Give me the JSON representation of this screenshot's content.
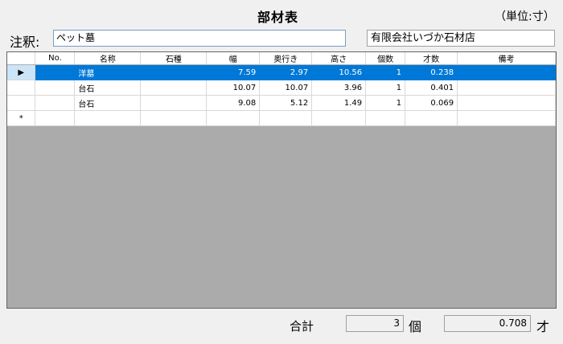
{
  "header": {
    "title": "部材表",
    "unit": "（単位:寸）"
  },
  "note": {
    "label": "注釈:",
    "value": "ペット墓"
  },
  "company": {
    "value": "有限会社いづか石材店"
  },
  "table": {
    "columns": [
      "No.",
      "名称",
      "石種",
      "幅",
      "奥行き",
      "高さ",
      "個数",
      "才数",
      "備考"
    ],
    "rows": [
      {
        "no": "",
        "name": "洋墓",
        "stone": "",
        "width": "7.59",
        "depth": "2.97",
        "height": "10.56",
        "count": "1",
        "size": "0.238",
        "note": ""
      },
      {
        "no": "",
        "name": "台石",
        "stone": "",
        "width": "10.07",
        "depth": "10.07",
        "height": "3.96",
        "count": "1",
        "size": "0.401",
        "note": ""
      },
      {
        "no": "",
        "name": "台石",
        "stone": "",
        "width": "9.08",
        "depth": "5.12",
        "height": "1.49",
        "count": "1",
        "size": "0.069",
        "note": ""
      }
    ],
    "current_row_marker": "▶",
    "new_row_marker": "*"
  },
  "footer": {
    "total_label": "合計",
    "count_value": "3",
    "count_unit": "個",
    "size_value": "0.708",
    "size_unit": "才"
  },
  "colors": {
    "selection": "#0078d7",
    "grid_background": "#ababab"
  }
}
